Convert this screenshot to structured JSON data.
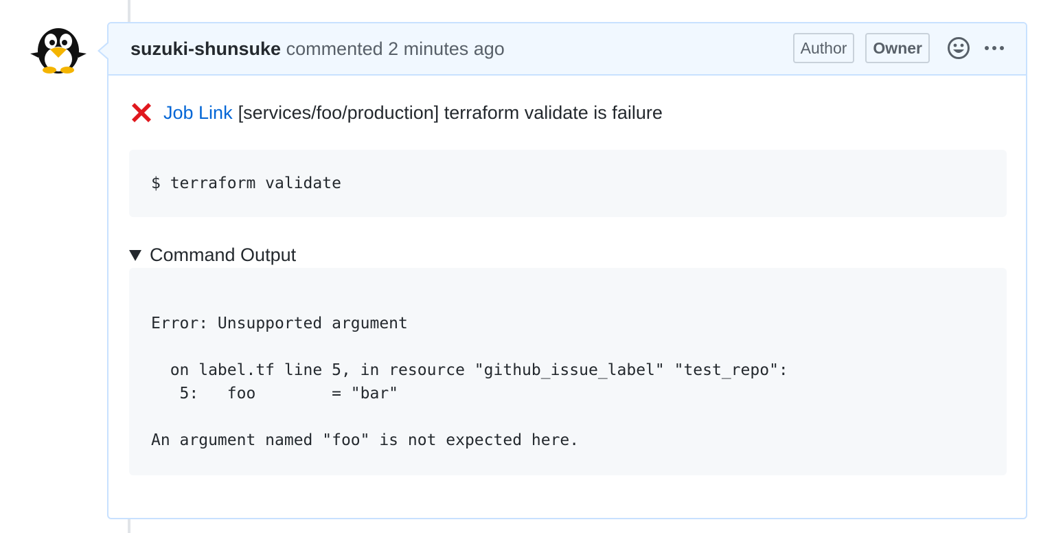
{
  "comment": {
    "author": "suzuki-shunsuke",
    "action": "commented",
    "time": "2 minutes ago",
    "badges": {
      "author": "Author",
      "owner": "Owner"
    },
    "icons": {
      "avatar": "penguin-avatar",
      "emoji": "smiley-icon",
      "more": "kebab-horizontal-icon",
      "status": "cross-mark-icon"
    }
  },
  "body": {
    "job_link": "Job Link",
    "status_text": "[services/foo/production] terraform validate is failure",
    "command": "$ terraform validate",
    "details_label": "Command Output",
    "output_lines": [
      "Error: Unsupported argument",
      "",
      "  on label.tf line 5, in resource \"github_issue_label\" \"test_repo\":",
      "   5:   foo        = \"bar\"",
      "",
      "An argument named \"foo\" is not expected here."
    ]
  },
  "colors": {
    "link": "#0366d6",
    "header_bg": "#f1f8ff",
    "border": "#c8e1ff",
    "fail": "#e0181e",
    "code_bg": "#f6f8fa"
  }
}
